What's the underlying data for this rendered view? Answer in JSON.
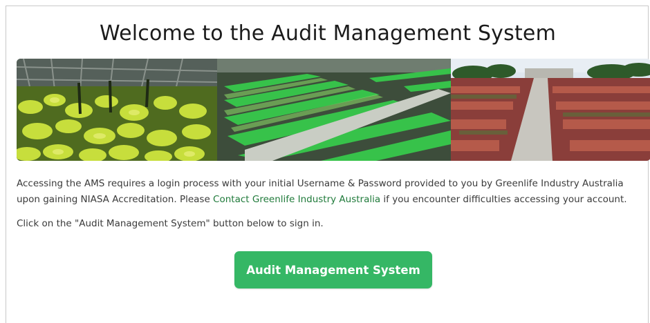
{
  "page": {
    "title": "Welcome to the Audit Management System"
  },
  "intro": {
    "text_before_link": "Accessing the AMS requires a login process with your initial Username & Password provided to you by Greenlife Industry Australia upon gaining NIASA Accreditation. Please ",
    "link_label": "Contact Greenlife Industry Australia",
    "text_after_link": " if you encounter difficulties accessing your account."
  },
  "instruction": {
    "text": "Click on the \"Audit Management System\" button below to sign in."
  },
  "cta": {
    "label": "Audit Management System"
  },
  "colors": {
    "button": "#35b765",
    "link": "#1f7a3a",
    "title": "#1b1b1b"
  }
}
